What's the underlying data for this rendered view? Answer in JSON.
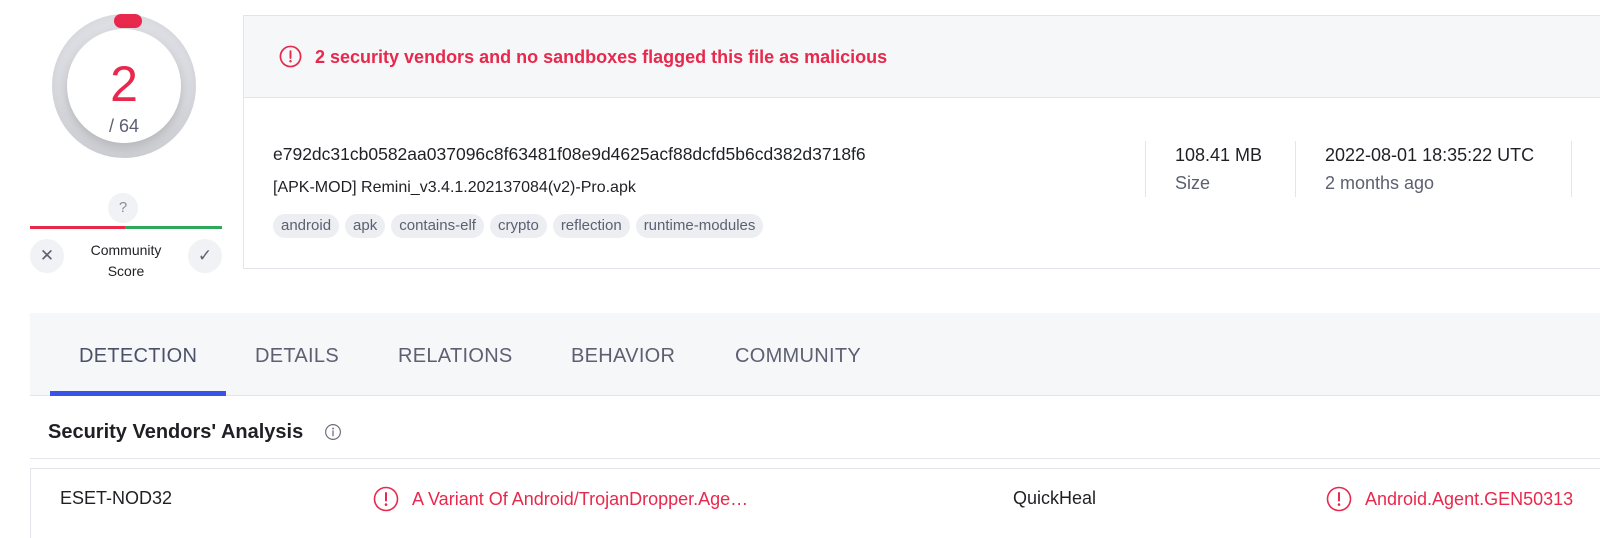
{
  "score": {
    "detections": "2",
    "total": "/ 64"
  },
  "community": {
    "unknown_mark": "?",
    "label": "Community\nScore",
    "label_line1": "Community",
    "label_line2": "Score",
    "downvote_glyph": "✕",
    "upvote_glyph": "✓"
  },
  "summary": {
    "alert": "2 security vendors and no sandboxes flagged this file as malicious",
    "hash": "e792dc31cb0582aa037096c8f63481f08e9d4625acf88dcfd5b6cd382d3718f6",
    "filename": "[APK-MOD] Remini_v3.4.1.202137084(v2)-Pro.apk",
    "tags": [
      "android",
      "apk",
      "contains-elf",
      "crypto",
      "reflection",
      "runtime-modules"
    ],
    "size_value": "108.41 MB",
    "size_label": "Size",
    "date_value": "2022-08-01 18:35:22 UTC",
    "date_label": "2 months ago"
  },
  "tabs": [
    "DETECTION",
    "DETAILS",
    "RELATIONS",
    "BEHAVIOR",
    "COMMUNITY"
  ],
  "active_tab": "DETECTION",
  "vendors_section": {
    "title": "Security Vendors' Analysis"
  },
  "detections": [
    {
      "vendor": "ESET-NOD32",
      "result": "A Variant Of Android/TrojanDropper.Age…"
    },
    {
      "vendor": "QuickHeal",
      "result": "Android.Agent.GEN50313"
    }
  ],
  "colors": {
    "malicious": "#e8284c",
    "accent": "#3953e8",
    "harmless": "#2ea85b"
  },
  "icons": {
    "alert": "exclamation-circle-icon",
    "info": "info-circle-icon",
    "close": "close-icon",
    "check": "check-icon"
  }
}
